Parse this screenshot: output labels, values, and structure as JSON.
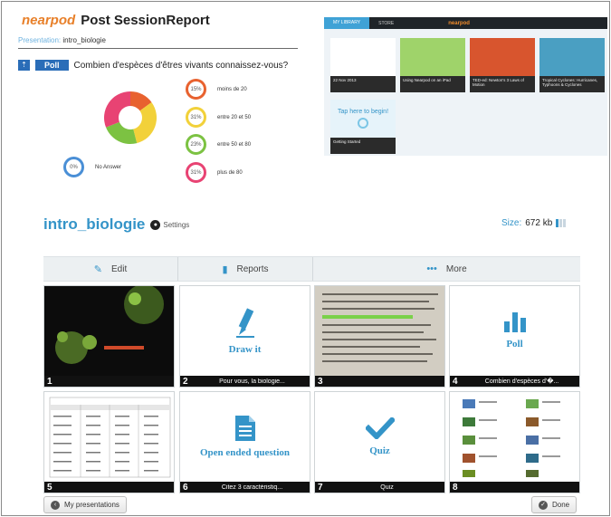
{
  "report": {
    "logo_text": "nearpod",
    "title": "Post SessionReport",
    "presentation_label": "Presentation:",
    "presentation_name": "intro_biologie",
    "poll_icon": "up-arrow-icon",
    "poll_tag": "Poll",
    "question": "Combien d'espèces d'êtres vivants connaissez-vous?",
    "answers": [
      {
        "pct": "15%",
        "label": "moins de 20",
        "color": "#e8622f",
        "share": 15
      },
      {
        "pct": "31%",
        "label": "entre 20 et 50",
        "color": "#f2d13a",
        "share": 31
      },
      {
        "pct": "23%",
        "label": "entre 50 et 80",
        "color": "#7cc242",
        "share": 23
      },
      {
        "pct": "31%",
        "label": "plus de 80",
        "color": "#e84373",
        "share": 31
      }
    ],
    "no_answer": {
      "pct": "0%",
      "label": "No Answer",
      "color": "#4a8fd6"
    }
  },
  "tablet": {
    "tabs": [
      "MY LIBRARY",
      "STORE"
    ],
    "logo": "nearpod",
    "cards": [
      {
        "caption": "22 Nov 2013",
        "color": "#ffffff"
      },
      {
        "caption": "Using Nearpod on an iPad",
        "color": "#9fd36a"
      },
      {
        "caption": "TED-ed: Newton's 3 Laws of Motion",
        "color": "#d8552e"
      },
      {
        "caption": "Tropical Cyclones: Hurricanes, Typhoons & Cyclones",
        "color": "#4a9fc2"
      },
      {
        "caption": "Getting Started",
        "color": "#e6f3fa"
      }
    ],
    "tap_text": "Tap here to begin!"
  },
  "presentation": {
    "title": "intro_biologie",
    "settings": "Settings",
    "size_label": "Size:",
    "size_value": "672 kb"
  },
  "toolbar": {
    "edit": "Edit",
    "reports": "Reports",
    "more": "More"
  },
  "slides": [
    {
      "num": "1",
      "label": "",
      "kind": "image"
    },
    {
      "num": "2",
      "label": "Pour vous, la biologie...",
      "kind": "draw",
      "title": "Draw it"
    },
    {
      "num": "3",
      "label": "",
      "kind": "image"
    },
    {
      "num": "4",
      "label": "Combien d'espèces d'�...",
      "kind": "poll",
      "title": "Poll"
    },
    {
      "num": "5",
      "label": "",
      "kind": "image"
    },
    {
      "num": "6",
      "label": "Citez 3 caractéristiq...",
      "kind": "open",
      "title": "Open ended question"
    },
    {
      "num": "7",
      "label": "Quiz",
      "kind": "quiz",
      "title": "Quiz"
    },
    {
      "num": "8",
      "label": "",
      "kind": "image"
    }
  ],
  "buttons": {
    "my_presentations": "My presentations",
    "done": "Done"
  }
}
